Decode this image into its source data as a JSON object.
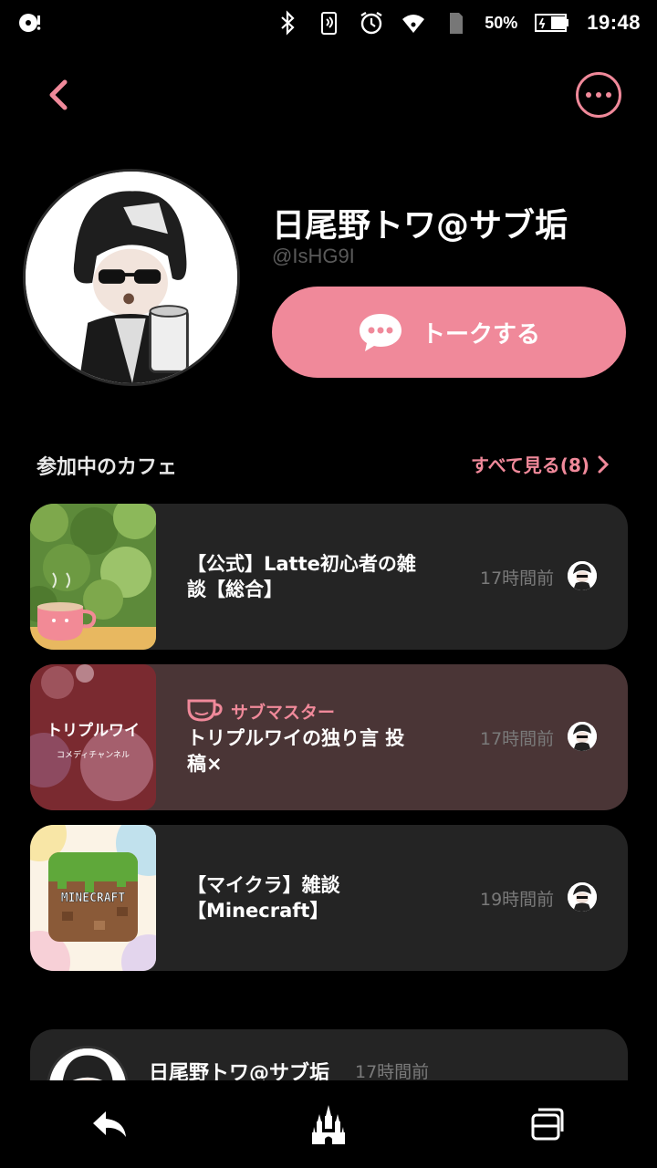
{
  "status_bar": {
    "battery": "50%",
    "time": "19:48"
  },
  "profile": {
    "name": "日尾野トワ@サブ垢",
    "handle": "@IsHG9I",
    "talk_label": "トークする"
  },
  "cafes_section": {
    "title": "参加中のカフェ",
    "see_all": "すべて見る(8)"
  },
  "cafes": [
    {
      "name_line1": "【公式】Latte初心者の雑",
      "name_line2": "談【総合】",
      "role": "",
      "time": "17時間前"
    },
    {
      "name_line1": "トリプルワイの独り言 投",
      "name_line2": "稿×",
      "role": "サブマスター",
      "time": "17時間前",
      "thumb_text": "トリプルワイ",
      "thumb_sub": "コメディチャンネル"
    },
    {
      "name_line1": "【マイクラ】雑談",
      "name_line2": "【Minecraft】",
      "role": "",
      "time": "19時間前",
      "thumb_text": "MINECRAFT"
    }
  ],
  "post": {
    "author": "日尾野トワ@サブ垢",
    "time": "17時間前"
  },
  "colors": {
    "accent": "#f0899a",
    "card": "#242424",
    "card_highlight": "#4a3536"
  }
}
